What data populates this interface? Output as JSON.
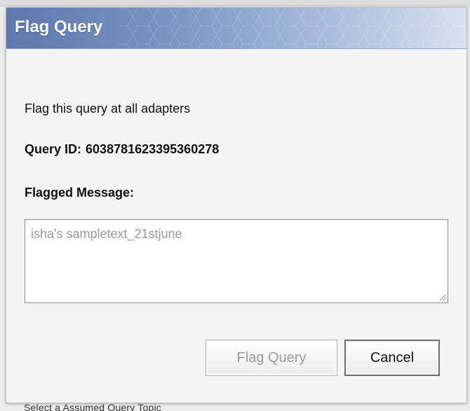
{
  "dialog": {
    "title": "Flag Query",
    "intro_text": "Flag this query at all adapters",
    "query_id_label": "Query ID:",
    "query_id_value": "6038781623395360278",
    "message_label": "Flagged Message:",
    "message_value": "isha's sampletext_21stjune",
    "flag_button_label": "Flag Query",
    "cancel_button_label": "Cancel"
  },
  "background": {
    "bottom_text": "Select a  Assumed  Query Topic"
  },
  "colors": {
    "title_bar_start": "#5d79ad",
    "title_bar_end": "#d7e1ef",
    "title_text": "#ffffff",
    "disabled_text": "#9a9a9a"
  },
  "state": {
    "flag_button_disabled": true
  }
}
